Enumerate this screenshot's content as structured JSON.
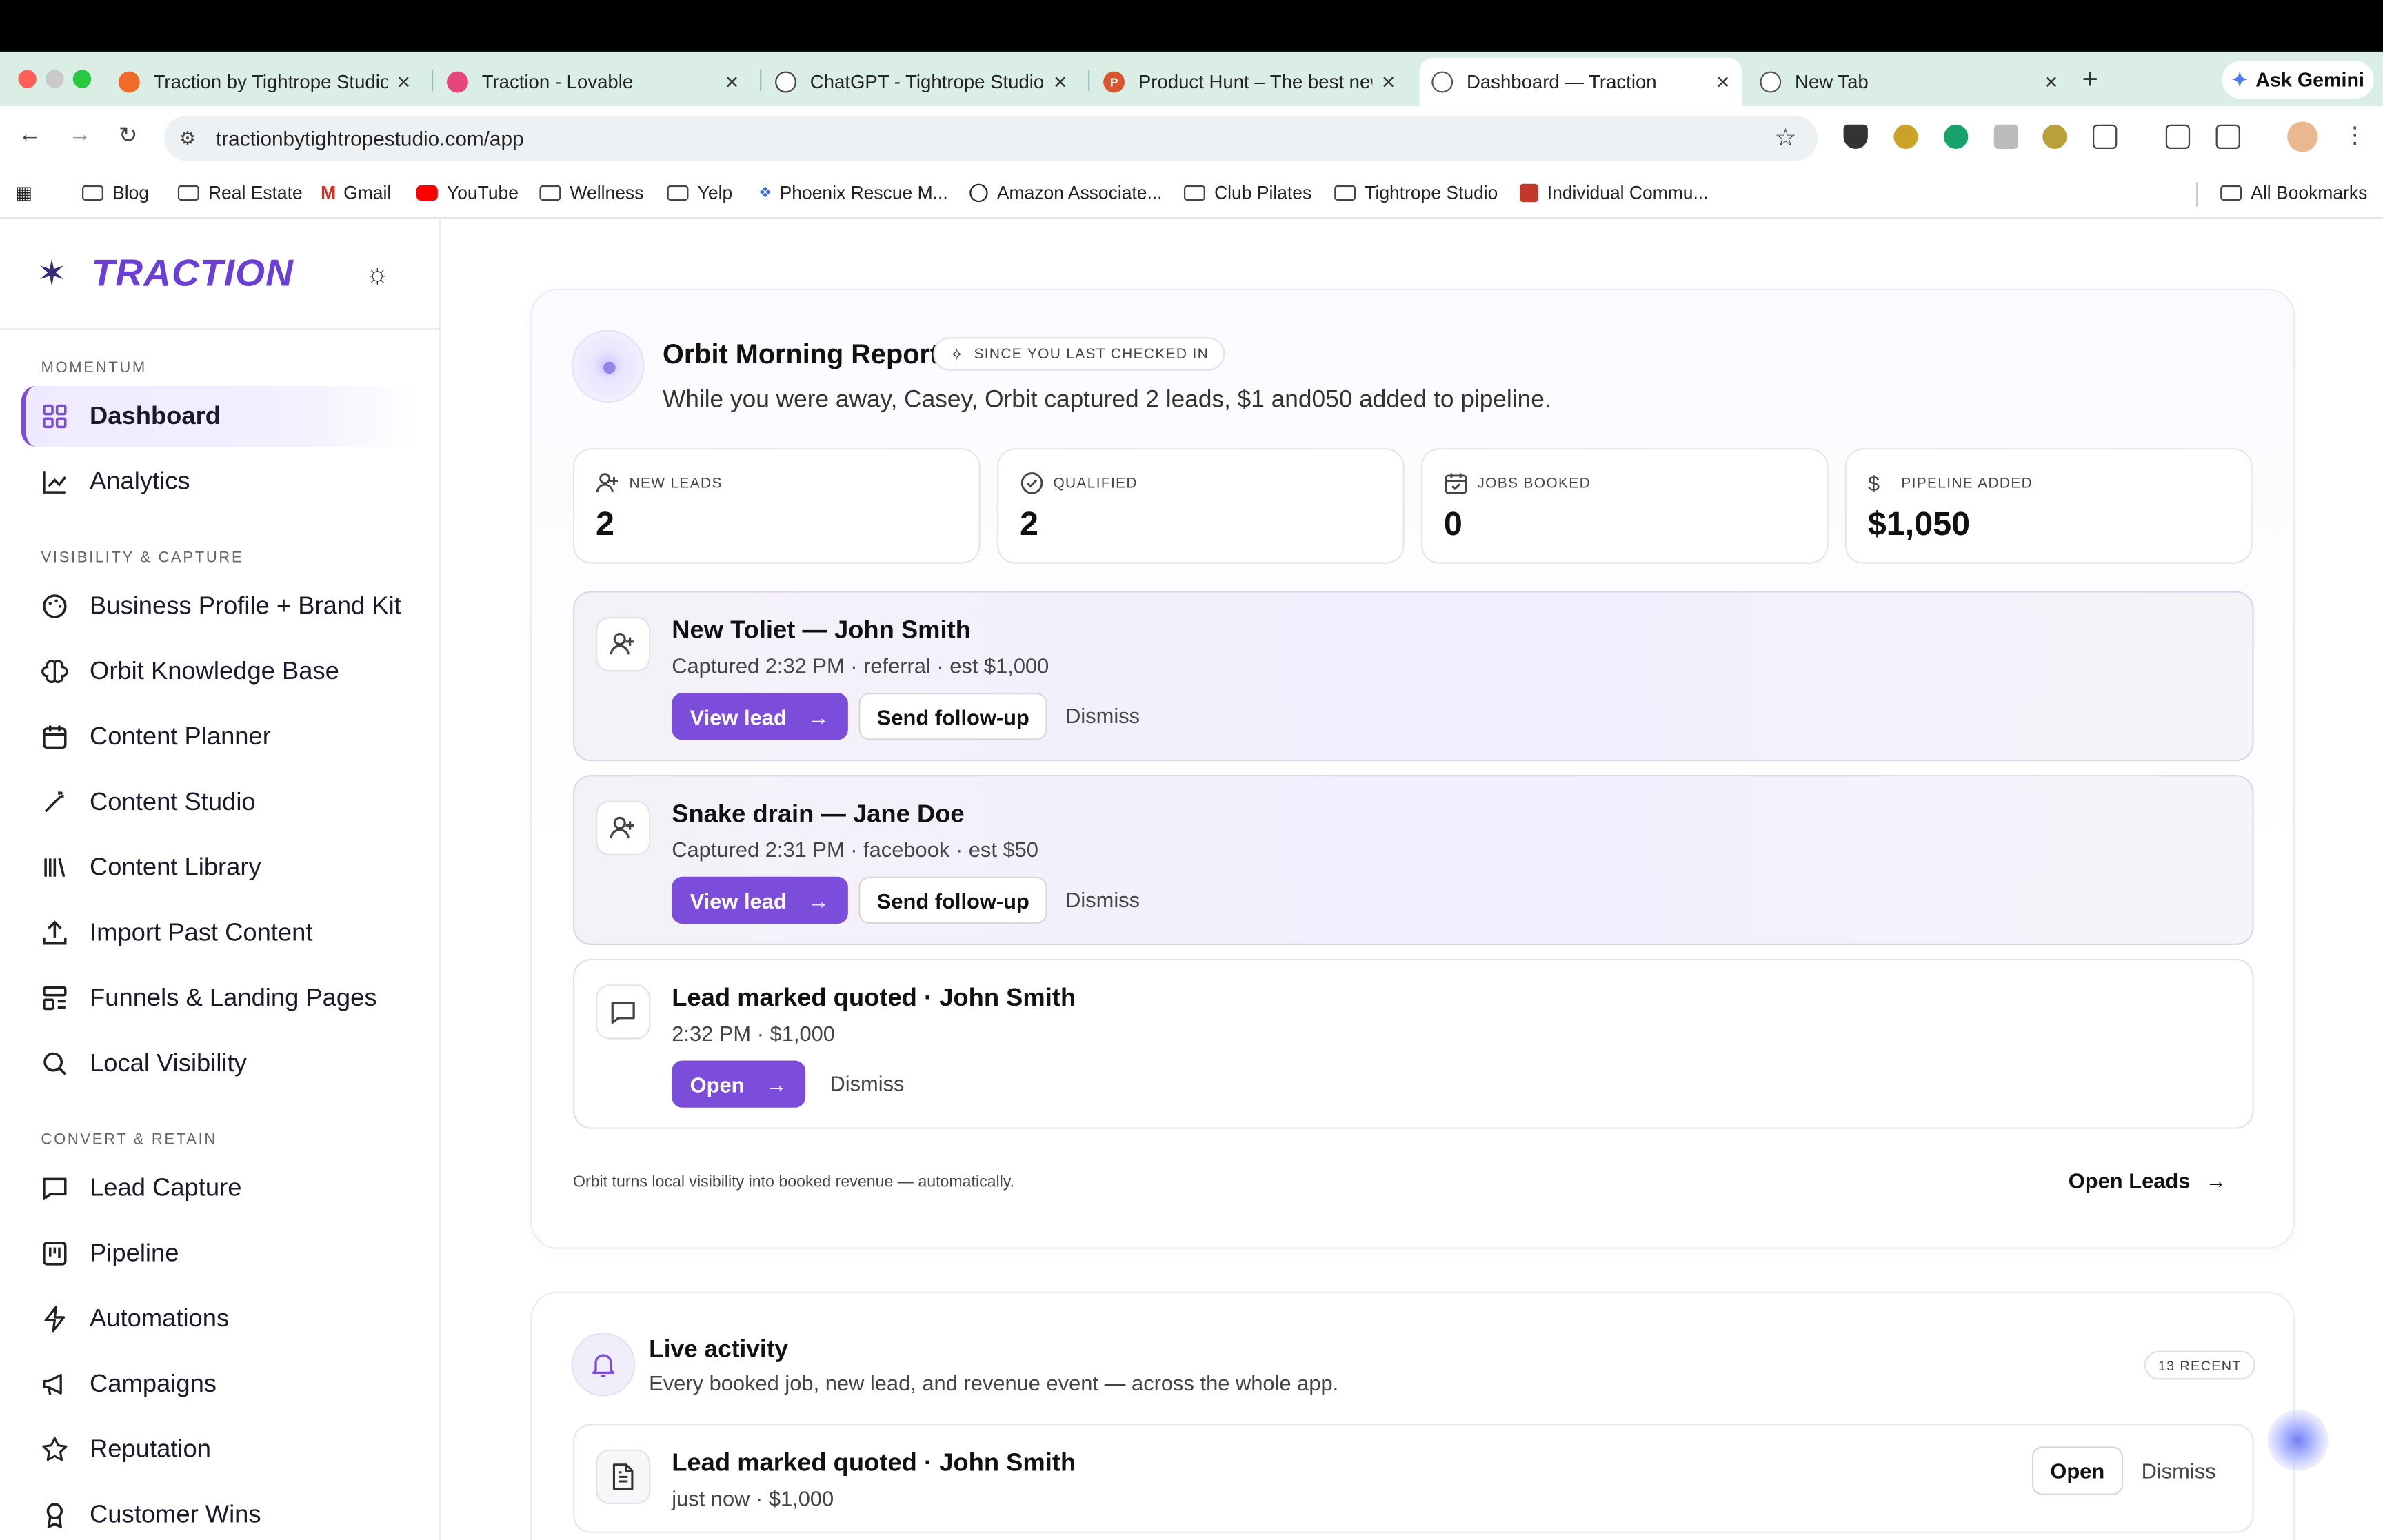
{
  "browser": {
    "tabs": [
      {
        "title": "Traction by Tightrope Studio |",
        "favicon_color": "#f06a2a"
      },
      {
        "title": "Traction - Lovable",
        "favicon_color": "#e8457a"
      },
      {
        "title": "ChatGPT - Tightrope Studio",
        "favicon_color": "#444444"
      },
      {
        "title": "Product Hunt – The best new",
        "favicon_color": "#da552f"
      },
      {
        "title": "Dashboard — Traction",
        "favicon_color": "#555555"
      },
      {
        "title": "New Tab",
        "favicon_color": "#555555"
      }
    ],
    "ask_gemini": "Ask Gemini",
    "url": "tractionbytightropestudio.com/app",
    "bookmarks": [
      {
        "label": "Blog",
        "type": "folder"
      },
      {
        "label": "Real Estate",
        "type": "folder"
      },
      {
        "label": "Gmail",
        "type": "link",
        "color": "#d93025"
      },
      {
        "label": "YouTube",
        "type": "link",
        "color": "#ff0000"
      },
      {
        "label": "Wellness",
        "type": "folder"
      },
      {
        "label": "Yelp",
        "type": "folder"
      },
      {
        "label": "Phoenix Rescue M...",
        "type": "link",
        "color": "#3d6fd6"
      },
      {
        "label": "Amazon Associate...",
        "type": "link",
        "color": "#222222"
      },
      {
        "label": "Club Pilates",
        "type": "folder"
      },
      {
        "label": "Tightrope Studio",
        "type": "folder"
      },
      {
        "label": "Individual Commu...",
        "type": "link",
        "color": "#c0392b"
      }
    ],
    "all_bookmarks": "All Bookmarks"
  },
  "sidebar": {
    "brand": "TRACTION",
    "sections": {
      "momentum": "MOMENTUM",
      "visibility": "VISIBILITY & CAPTURE",
      "convert": "CONVERT & RETAIN"
    },
    "items": {
      "dashboard": "Dashboard",
      "analytics": "Analytics",
      "business_profile": "Business Profile + Brand Kit",
      "knowledge_base": "Orbit Knowledge Base",
      "content_planner": "Content Planner",
      "content_studio": "Content Studio",
      "content_library": "Content Library",
      "import_content": "Import Past Content",
      "funnels": "Funnels & Landing Pages",
      "local_visibility": "Local Visibility",
      "lead_capture": "Lead Capture",
      "pipeline": "Pipeline",
      "automations": "Automations",
      "campaigns": "Campaigns",
      "reputation": "Reputation",
      "customer_wins": "Customer Wins"
    }
  },
  "report": {
    "title": "Orbit Morning Report",
    "badge": "SINCE YOU LAST CHECKED IN",
    "summary": "While you were away, Casey, Orbit captured 2 leads, $1 and050 added to pipeline.",
    "stats": [
      {
        "label": "NEW LEADS",
        "value": "2"
      },
      {
        "label": "QUALIFIED",
        "value": "2"
      },
      {
        "label": "JOBS BOOKED",
        "value": "0"
      },
      {
        "label": "PIPELINE ADDED",
        "value": "$1,050"
      }
    ],
    "items": [
      {
        "title": "New Toliet — John Smith",
        "meta": "Captured 2:32 PM · referral · est $1,000",
        "primary": "View lead",
        "secondary": "Send follow-up",
        "dismiss": "Dismiss"
      },
      {
        "title": "Snake drain — Jane Doe",
        "meta": "Captured 2:31 PM · facebook · est $50",
        "primary": "View lead",
        "secondary": "Send follow-up",
        "dismiss": "Dismiss"
      },
      {
        "title": "Lead marked quoted · John Smith",
        "meta": "2:32 PM · $1,000",
        "primary": "Open",
        "dismiss": "Dismiss"
      }
    ],
    "footer": "Orbit turns local visibility into booked revenue — automatically.",
    "open_leads": "Open Leads"
  },
  "activity": {
    "title": "Live activity",
    "subtitle": "Every booked job, new lead, and revenue event — across the whole app.",
    "count": "13 RECENT",
    "rows": [
      {
        "title": "Lead marked quoted · John Smith",
        "meta": "just now · $1,000",
        "open": "Open",
        "dismiss": "Dismiss"
      }
    ]
  },
  "colors": {
    "accent": "#7c4ddb",
    "brand": "#6b3fd6"
  }
}
